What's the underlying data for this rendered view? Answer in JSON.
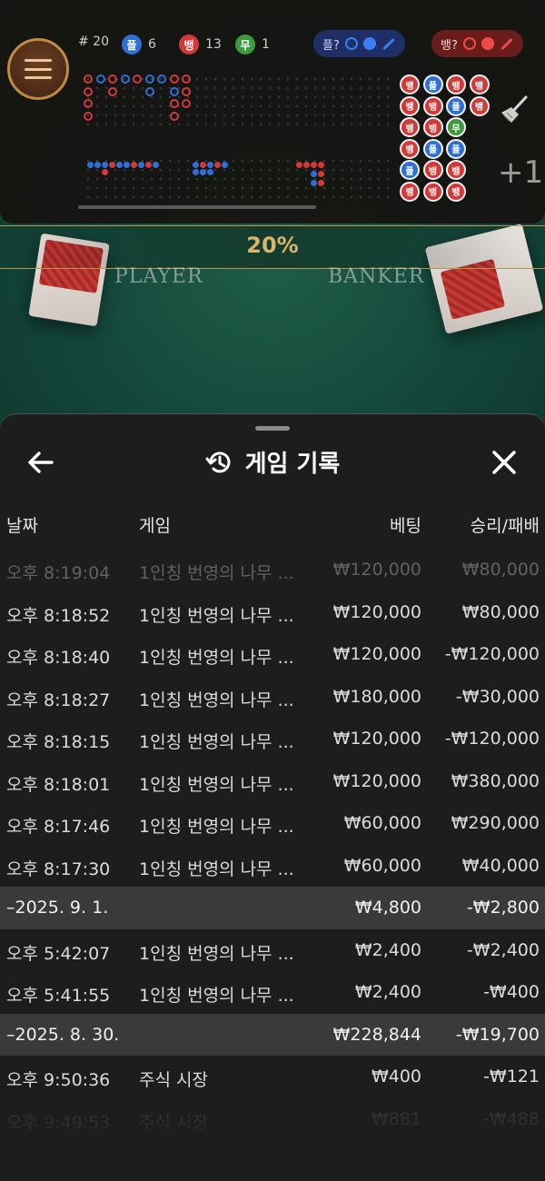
{
  "game": {
    "percent": "20%",
    "player_label": "PLAYER",
    "banker_label": "BANKER",
    "plus_label": "+1"
  },
  "stats": {
    "rounds": "# 20",
    "player_glyph": "플",
    "player_count": "6",
    "banker_glyph": "뱅",
    "banker_count": "13",
    "tie_glyph": "무",
    "tie_count": "1"
  },
  "predict": {
    "player_label": "플?",
    "banker_label": "뱅?"
  },
  "colors": {
    "player": "#2f6fd6",
    "banker": "#d23a3a",
    "tie": "#3f9a3f",
    "gold": "#c08a44"
  },
  "main_road": [
    [
      "뱅",
      "플",
      "뱅",
      "뱅"
    ],
    [
      "뱅",
      "뱅",
      "플",
      "뱅"
    ],
    [
      "뱅",
      "뱅",
      "무"
    ],
    [
      "뱅",
      "플",
      "플"
    ],
    [
      "플",
      "뱅",
      "뱅"
    ],
    [
      "뱅",
      "뱅",
      "뱅"
    ]
  ],
  "history": {
    "title": "게임 기록",
    "columns": {
      "date": "날짜",
      "game": "게임",
      "bet": "베팅",
      "result": "승리/패배"
    },
    "rows": [
      {
        "type": "entry",
        "time": "오후 8:19:04",
        "game": "1인칭 번영의 나무 ...",
        "bet": "₩120,000",
        "result": "₩80,000"
      },
      {
        "type": "entry",
        "time": "오후 8:18:52",
        "game": "1인칭 번영의 나무 ...",
        "bet": "₩120,000",
        "result": "₩80,000"
      },
      {
        "type": "entry",
        "time": "오후 8:18:40",
        "game": "1인칭 번영의 나무 ...",
        "bet": "₩120,000",
        "result": "-₩120,000"
      },
      {
        "type": "entry",
        "time": "오후 8:18:27",
        "game": "1인칭 번영의 나무 ...",
        "bet": "₩180,000",
        "result": "-₩30,000"
      },
      {
        "type": "entry",
        "time": "오후 8:18:15",
        "game": "1인칭 번영의 나무 ...",
        "bet": "₩120,000",
        "result": "-₩120,000"
      },
      {
        "type": "entry",
        "time": "오후 8:18:01",
        "game": "1인칭 번영의 나무 ...",
        "bet": "₩120,000",
        "result": "₩380,000"
      },
      {
        "type": "entry",
        "time": "오후 8:17:46",
        "game": "1인칭 번영의 나무 ...",
        "bet": "₩60,000",
        "result": "₩290,000"
      },
      {
        "type": "entry",
        "time": "오후 8:17:30",
        "game": "1인칭 번영의 나무 ...",
        "bet": "₩60,000",
        "result": "₩40,000"
      },
      {
        "type": "date",
        "time": "–2025. 9. 1.",
        "game": "",
        "bet": "₩4,800",
        "result": "-₩2,800"
      },
      {
        "type": "entry",
        "time": "오후 5:42:07",
        "game": "1인칭 번영의 나무 ...",
        "bet": "₩2,400",
        "result": "-₩2,400"
      },
      {
        "type": "entry",
        "time": "오후 5:41:55",
        "game": "1인칭 번영의 나무 ...",
        "bet": "₩2,400",
        "result": "-₩400"
      },
      {
        "type": "date",
        "time": "–2025. 8. 30.",
        "game": "",
        "bet": "₩228,844",
        "result": "-₩19,700"
      },
      {
        "type": "entry",
        "time": "오후 9:50:36",
        "game": "주식 시장",
        "bet": "₩400",
        "result": "-₩121"
      },
      {
        "type": "entry",
        "time": "오후 9:49:53",
        "game": "주식 시장",
        "bet": "₩881",
        "result": "-₩488"
      }
    ]
  }
}
